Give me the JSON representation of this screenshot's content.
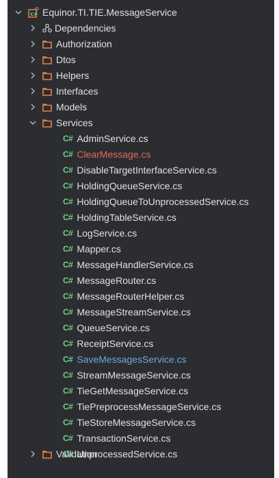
{
  "colors": {
    "panel_bg": "#2b2d30",
    "text": "#dfe1e5",
    "modified_red": "#e5675d",
    "changed_blue": "#6fa8dc",
    "cs_green": "#68d08a",
    "folder_orange": "#e8804a"
  },
  "tree": {
    "project": {
      "label": "Equinor.TI.TIE.MessageService",
      "icon": "csharp-project-icon"
    },
    "dependencies": {
      "label": "Dependencies",
      "icon": "dependencies-icon"
    },
    "folders": {
      "authorization": "Authorization",
      "dtos": "Dtos",
      "helpers": "Helpers",
      "interfaces": "Interfaces",
      "models": "Models",
      "services": "Services",
      "validation": "Validation"
    },
    "cs_icon_text": "C#",
    "services_files": [
      {
        "name": "AdminService.cs",
        "status": "normal"
      },
      {
        "name": "ClearMessage.cs",
        "status": "modified"
      },
      {
        "name": "DisableTargetInterfaceService.cs",
        "status": "normal"
      },
      {
        "name": "HoldingQueueService.cs",
        "status": "normal"
      },
      {
        "name": "HoldingQueueToUnprocessedService.cs",
        "status": "normal"
      },
      {
        "name": "HoldingTableService.cs",
        "status": "normal"
      },
      {
        "name": "LogService.cs",
        "status": "normal"
      },
      {
        "name": "Mapper.cs",
        "status": "normal"
      },
      {
        "name": "MessageHandlerService.cs",
        "status": "normal"
      },
      {
        "name": "MessageRouter.cs",
        "status": "normal"
      },
      {
        "name": "MessageRouterHelper.cs",
        "status": "normal"
      },
      {
        "name": "MessageStreamService.cs",
        "status": "normal"
      },
      {
        "name": "QueueService.cs",
        "status": "normal"
      },
      {
        "name": "ReceiptService.cs",
        "status": "normal"
      },
      {
        "name": "SaveMessagesService.cs",
        "status": "changed"
      },
      {
        "name": "StreamMessageService.cs",
        "status": "normal"
      },
      {
        "name": "TieGetMessageService.cs",
        "status": "normal"
      },
      {
        "name": "TiePreprocessMessageService.cs",
        "status": "normal"
      },
      {
        "name": "TieStoreMessageService.cs",
        "status": "normal"
      },
      {
        "name": "TransactionService.cs",
        "status": "normal"
      },
      {
        "name": "UnprocessedService.cs",
        "status": "normal"
      }
    ]
  }
}
